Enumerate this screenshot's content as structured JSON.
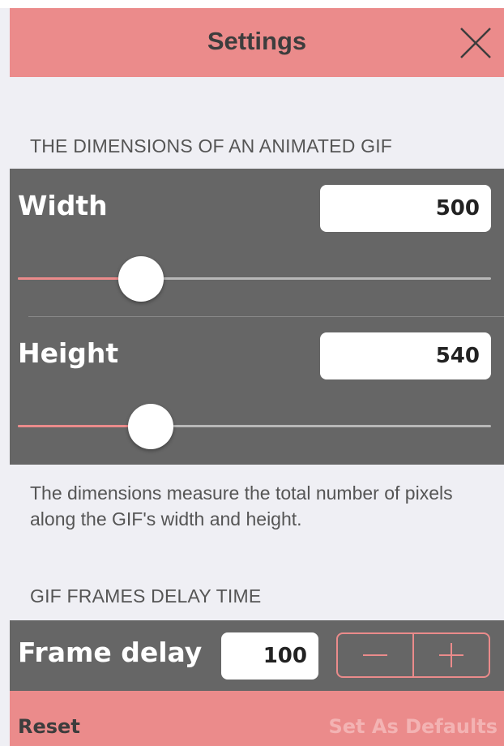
{
  "nav": {
    "title": "Settings"
  },
  "dimensions": {
    "section_header": "THE DIMENSIONS OF AN ANIMATED GIF",
    "width": {
      "label": "Width",
      "value": "500",
      "slider_fraction": 0.26
    },
    "height": {
      "label": "Height",
      "value": "540",
      "slider_fraction": 0.28
    },
    "footnote": "The dimensions measure the total number of pixels along the GIF's width and height."
  },
  "delay": {
    "section_header": "GIF FRAMES DELAY TIME",
    "label": "Frame delay",
    "value": "100"
  },
  "footer": {
    "reset_label": "Reset",
    "defaults_label": "Set As Defaults"
  },
  "colors": {
    "accent": "#eb8b8b",
    "panel": "#666666",
    "background": "#efeff4"
  }
}
